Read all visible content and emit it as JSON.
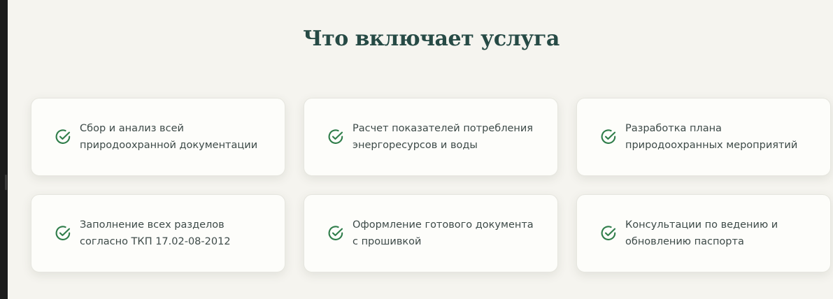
{
  "section": {
    "title": "Что включает услуга"
  },
  "features": [
    {
      "text": "Сбор и анализ всей природоохранной документации",
      "icon": "check-circle-icon"
    },
    {
      "text": "Расчет показателей потребления энергоресурсов и воды",
      "icon": "check-circle-icon"
    },
    {
      "text": "Разработка плана природоохранных мероприятий",
      "icon": "check-circle-icon"
    },
    {
      "text": "Заполнение всех разделов согласно ТКП 17.02-08-2012",
      "icon": "check-circle-icon"
    },
    {
      "text": "Оформление готового документа с прошивкой",
      "icon": "check-circle-icon"
    },
    {
      "text": "Консультации по ведению и обновлению паспорта",
      "icon": "check-circle-icon"
    }
  ],
  "colors": {
    "background": "#f5f4ef",
    "title": "#264a45",
    "accent_green": "#2f7d4a",
    "card_background": "#fdfdfa",
    "text": "#3d4a48"
  }
}
